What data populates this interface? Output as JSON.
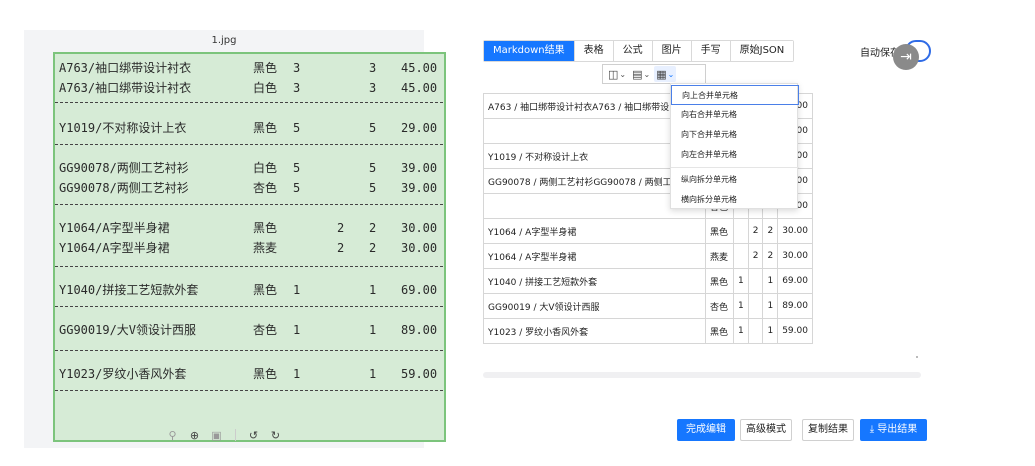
{
  "image_panel": {
    "file_name": "1.jpg",
    "scan_rows": [
      {
        "name": "A763/袖口绑带设计衬衣",
        "color": "黑色",
        "a": "3",
        "b": "",
        "c": "3",
        "amount": "45.00"
      },
      {
        "name": "A763/袖口绑带设计衬衣",
        "color": "白色",
        "a": "3",
        "b": "",
        "c": "3",
        "amount": "45.00"
      },
      {
        "name": "Y1019/不对称设计上衣",
        "color": "黑色",
        "a": "5",
        "b": "",
        "c": "5",
        "amount": "29.00"
      },
      {
        "name": "GG90078/两侧工艺衬衫",
        "color": "白色",
        "a": "5",
        "b": "",
        "c": "5",
        "amount": "39.00"
      },
      {
        "name": "GG90078/两侧工艺衬衫",
        "color": "杏色",
        "a": "5",
        "b": "",
        "c": "5",
        "amount": "39.00"
      },
      {
        "name": "Y1064/A字型半身裙",
        "color": "黑色",
        "a": "",
        "b": "2",
        "c": "2",
        "amount": "30.00"
      },
      {
        "name": "Y1064/A字型半身裙",
        "color": "燕麦",
        "a": "",
        "b": "2",
        "c": "2",
        "amount": "30.00"
      },
      {
        "name": "Y1040/拼接工艺短款外套",
        "color": "黑色",
        "a": "1",
        "b": "",
        "c": "1",
        "amount": "69.00"
      },
      {
        "name": "GG90019/大V领设计西服",
        "color": "杏色",
        "a": "1",
        "b": "",
        "c": "1",
        "amount": "89.00"
      },
      {
        "name": "Y1023/罗纹小香风外套",
        "color": "黑色",
        "a": "1",
        "b": "",
        "c": "1",
        "amount": "59.00"
      }
    ],
    "zoom_icons": [
      "zoom-out-icon",
      "zoom-in-icon",
      "fit-icon",
      "rotate-left-icon",
      "rotate-right-icon"
    ]
  },
  "result_panel": {
    "tabs": [
      {
        "label": "Markdown结果",
        "active": true
      },
      {
        "label": "表格",
        "active": false
      },
      {
        "label": "公式",
        "active": false
      },
      {
        "label": "图片",
        "active": false
      },
      {
        "label": "手写",
        "active": false
      },
      {
        "label": "原始JSON",
        "active": false
      }
    ],
    "autosave_label": "自动保存",
    "exit_icon": "exit-icon",
    "toolbar_icons": [
      "column-icon",
      "row-icon",
      "cell-merge-icon"
    ],
    "table_rows": [
      {
        "name": "A763 / 袖口绑带设计衬衣A763 / 袖口绑带设",
        "color": "",
        "a": "",
        "b": "",
        "c": "",
        "amount": "45.00"
      },
      {
        "name": "",
        "color": "",
        "a": "",
        "b": "",
        "c": "",
        "amount": "45.00"
      },
      {
        "name": "Y1019 / 不对称设计上衣",
        "color": "",
        "a": "",
        "b": "",
        "c": "",
        "amount": "29.00"
      },
      {
        "name": "GG90078 / 两侧工艺衬衫GG90078 / 两侧工",
        "color": "",
        "a": "",
        "b": "",
        "c": "",
        "amount": "39.00"
      },
      {
        "name": "",
        "color": "杏色",
        "a": "5",
        "b": "",
        "c": "5",
        "amount": "39.00"
      },
      {
        "name": "Y1064 / A字型半身裙",
        "color": "黑色",
        "a": "",
        "b": "2",
        "c": "2",
        "amount": "30.00"
      },
      {
        "name": "Y1064 / A字型半身裙",
        "color": "燕麦",
        "a": "",
        "b": "2",
        "c": "2",
        "amount": "30.00"
      },
      {
        "name": "Y1040 / 拼接工艺短款外套",
        "color": "黑色",
        "a": "1",
        "b": "",
        "c": "1",
        "amount": "69.00"
      },
      {
        "name": "GG90019 / 大V领设计西服",
        "color": "杏色",
        "a": "1",
        "b": "",
        "c": "1",
        "amount": "89.00"
      },
      {
        "name": "Y1023 / 罗纹小香风外套",
        "color": "黑色",
        "a": "1",
        "b": "",
        "c": "1",
        "amount": "59.00"
      }
    ],
    "dropdown_items": [
      "向上合并单元格",
      "向右合并单元格",
      "向下合并单元格",
      "向左合并单元格",
      "纵向拆分单元格",
      "横向拆分单元格"
    ],
    "buttons": {
      "finish_edit": "完成编辑",
      "advanced_mode": "高级模式",
      "copy_result": "复制结果",
      "export_result": "导出结果"
    }
  },
  "colors": {
    "accent": "#1677ff",
    "scan_bg": "#d6ebd6",
    "scan_border": "#7cc47c"
  }
}
